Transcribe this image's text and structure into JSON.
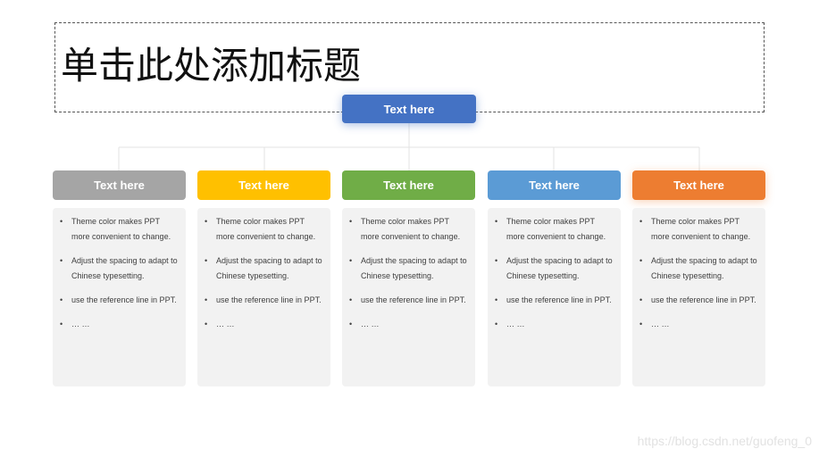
{
  "title": "单击此处添加标题",
  "root": {
    "label": "Text here",
    "color": "#4472c4"
  },
  "columns": [
    {
      "label": "Text here",
      "color": "#a5a5a5",
      "bullets": [
        "Theme color makes PPT more convenient to change.",
        "Adjust the spacing to adapt to Chinese typesetting.",
        "use the reference line in PPT.",
        "… …"
      ]
    },
    {
      "label": "Text here",
      "color": "#ffc000",
      "bullets": [
        "Theme color makes PPT more convenient to change.",
        "Adjust the spacing to adapt to Chinese typesetting.",
        "use the reference line in PPT.",
        "… …"
      ]
    },
    {
      "label": "Text here",
      "color": "#70ad47",
      "bullets": [
        "Theme color makes PPT more convenient to change.",
        "Adjust the spacing to adapt to Chinese typesetting.",
        "use the reference line in PPT.",
        "… …"
      ]
    },
    {
      "label": "Text here",
      "color": "#5b9bd5",
      "bullets": [
        "Theme color makes PPT more convenient to change.",
        "Adjust the spacing to adapt to Chinese typesetting.",
        "use the reference line in PPT.",
        "… …"
      ]
    },
    {
      "label": "Text here",
      "color": "#ed7d31",
      "bullets": [
        "Theme color makes PPT more convenient to change.",
        "Adjust the spacing to adapt to Chinese typesetting.",
        "use the reference line in PPT.",
        "… …"
      ]
    }
  ],
  "watermark": "https://blog.csdn.net/guofeng_0"
}
